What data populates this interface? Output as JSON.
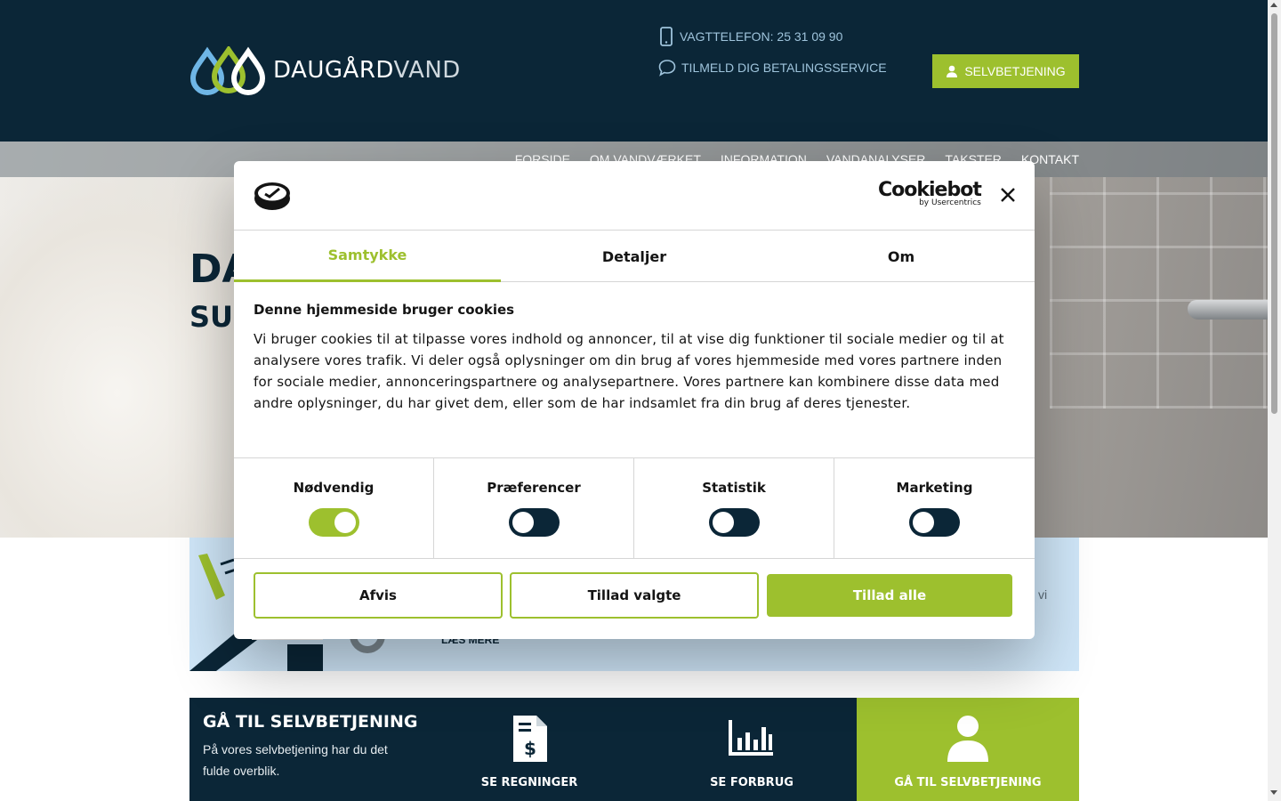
{
  "header": {
    "logo": {
      "brand_bold": "DAUGÅRD",
      "brand_thin": "VAND"
    },
    "phone": "VAGTTELEFON: 25 31 09 90",
    "betaling": "TILMELD DIG BETALINGSSERVICE",
    "self_service_button": "SELVBETJENING"
  },
  "nav": {
    "items": [
      "FORSIDE",
      "OM VANDVÆRKET",
      "INFORMATION",
      "VANDANALYSER",
      "TAKSTER",
      "KONTAKT"
    ]
  },
  "hero": {
    "title_fragment": "DA",
    "subtitle_fragment": "SUN"
  },
  "infoband": {
    "read_more": "LÆS MERE",
    "tail_text": "vi"
  },
  "selfservice": {
    "heading": "GÅ TIL SELVBETJENING",
    "text": "På vores selvbetjening har du det fulde overblik.",
    "items": [
      {
        "label": "SE REGNINGER",
        "icon": "invoice-icon"
      },
      {
        "label": "SE FORBRUG",
        "icon": "bar-chart-icon"
      },
      {
        "label": "GÅ TIL SELVBETJENING",
        "icon": "user-icon"
      }
    ]
  },
  "cookie_dialog": {
    "brand": "Cookiebot",
    "brand_sub": "by Usercentrics",
    "tabs": [
      "Samtykke",
      "Detaljer",
      "Om"
    ],
    "active_tab": "Samtykke",
    "heading": "Denne hjemmeside bruger cookies",
    "body": "Vi bruger cookies til at tilpasse vores indhold og annoncer, til at vise dig funktioner til sociale medier og til at analysere vores trafik. Vi deler også oplysninger om din brug af vores hjemmeside med vores partnere inden for sociale medier, annonceringspartnere og analysepartnere. Vores partnere kan kombinere disse data med andre oplysninger, du har givet dem, eller som de har indsamlet fra din brug af deres tjenester.",
    "categories": [
      {
        "label": "Nødvendig",
        "enabled": true
      },
      {
        "label": "Præferencer",
        "enabled": false
      },
      {
        "label": "Statistik",
        "enabled": false
      },
      {
        "label": "Marketing",
        "enabled": false
      }
    ],
    "buttons": {
      "reject": "Afvis",
      "allow_selected": "Tillad valgte",
      "allow_all": "Tillad alle"
    }
  },
  "colors": {
    "navy": "#0b2637",
    "accent_green": "#9dc02e",
    "light_blue": "#cfe6f8",
    "link_blue": "#9fc4dc"
  }
}
